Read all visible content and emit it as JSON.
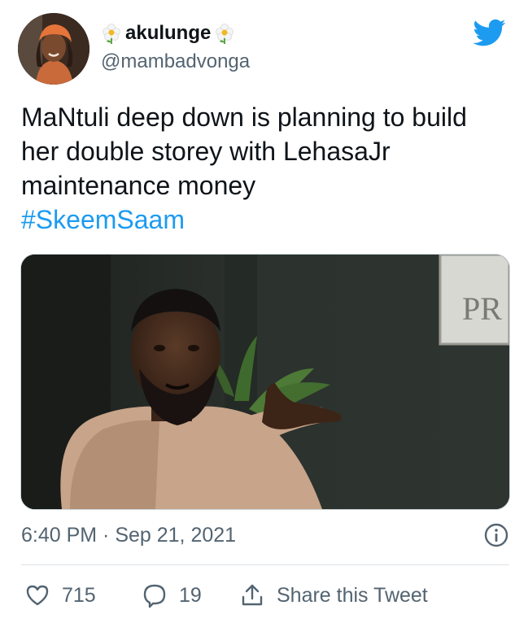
{
  "user": {
    "display_name": "akulunge",
    "handle": "@mambadvonga",
    "name_decoration_icon": "flower-emoji-icon"
  },
  "tweet": {
    "text": "MaNtuli deep down is planning to build her double storey with LehasaJr maintenance money",
    "hashtag": "#SkeemSaam"
  },
  "media": {
    "sign_text": "PR"
  },
  "meta": {
    "timestamp": "6:40 PM · Sep 21, 2021"
  },
  "actions": {
    "like_count": "715",
    "reply_count": "19",
    "share_label": "Share this Tweet"
  },
  "colors": {
    "brand": "#1d9bf0",
    "text_primary": "#0f1419",
    "text_secondary": "#536471"
  }
}
